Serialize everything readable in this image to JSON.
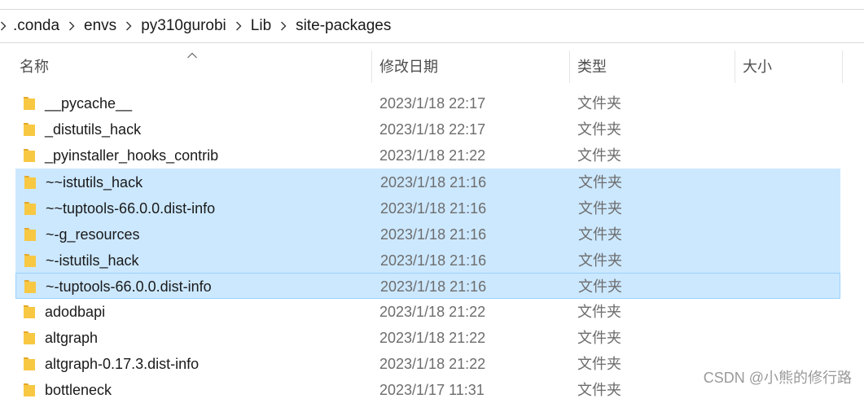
{
  "breadcrumb": {
    "items": [
      ".conda",
      "envs",
      "py310gurobi",
      "Lib",
      "site-packages"
    ]
  },
  "columns": {
    "name": "名称",
    "date": "修改日期",
    "type": "类型",
    "size": "大小"
  },
  "rows": [
    {
      "name": "__pycache__",
      "date": "2023/1/18 22:17",
      "type": "文件夹",
      "selected": false
    },
    {
      "name": "_distutils_hack",
      "date": "2023/1/18 22:17",
      "type": "文件夹",
      "selected": false
    },
    {
      "name": "_pyinstaller_hooks_contrib",
      "date": "2023/1/18 21:22",
      "type": "文件夹",
      "selected": false
    },
    {
      "name": "~~istutils_hack",
      "date": "2023/1/18 21:16",
      "type": "文件夹",
      "selected": true
    },
    {
      "name": "~~tuptools-66.0.0.dist-info",
      "date": "2023/1/18 21:16",
      "type": "文件夹",
      "selected": true
    },
    {
      "name": "~-g_resources",
      "date": "2023/1/18 21:16",
      "type": "文件夹",
      "selected": true
    },
    {
      "name": "~-istutils_hack",
      "date": "2023/1/18 21:16",
      "type": "文件夹",
      "selected": true
    },
    {
      "name": "~-tuptools-66.0.0.dist-info",
      "date": "2023/1/18 21:16",
      "type": "文件夹",
      "selected": true,
      "focused": true
    },
    {
      "name": "adodbapi",
      "date": "2023/1/18 21:22",
      "type": "文件夹",
      "selected": false
    },
    {
      "name": "altgraph",
      "date": "2023/1/18 21:22",
      "type": "文件夹",
      "selected": false
    },
    {
      "name": "altgraph-0.17.3.dist-info",
      "date": "2023/1/18 21:22",
      "type": "文件夹",
      "selected": false
    },
    {
      "name": "bottleneck",
      "date": "2023/1/17 11:31",
      "type": "文件夹",
      "selected": false
    }
  ],
  "watermark": "CSDN @小熊的修行路",
  "colors": {
    "selection": "#cce8ff",
    "focus_border": "#99d1ff",
    "folder_yellow": "#f8c843"
  },
  "icons": {
    "breadcrumb_separator": "chevron-right-icon",
    "sort_indicator": "sort-ascending-caret-icon",
    "folder": "folder-icon"
  }
}
